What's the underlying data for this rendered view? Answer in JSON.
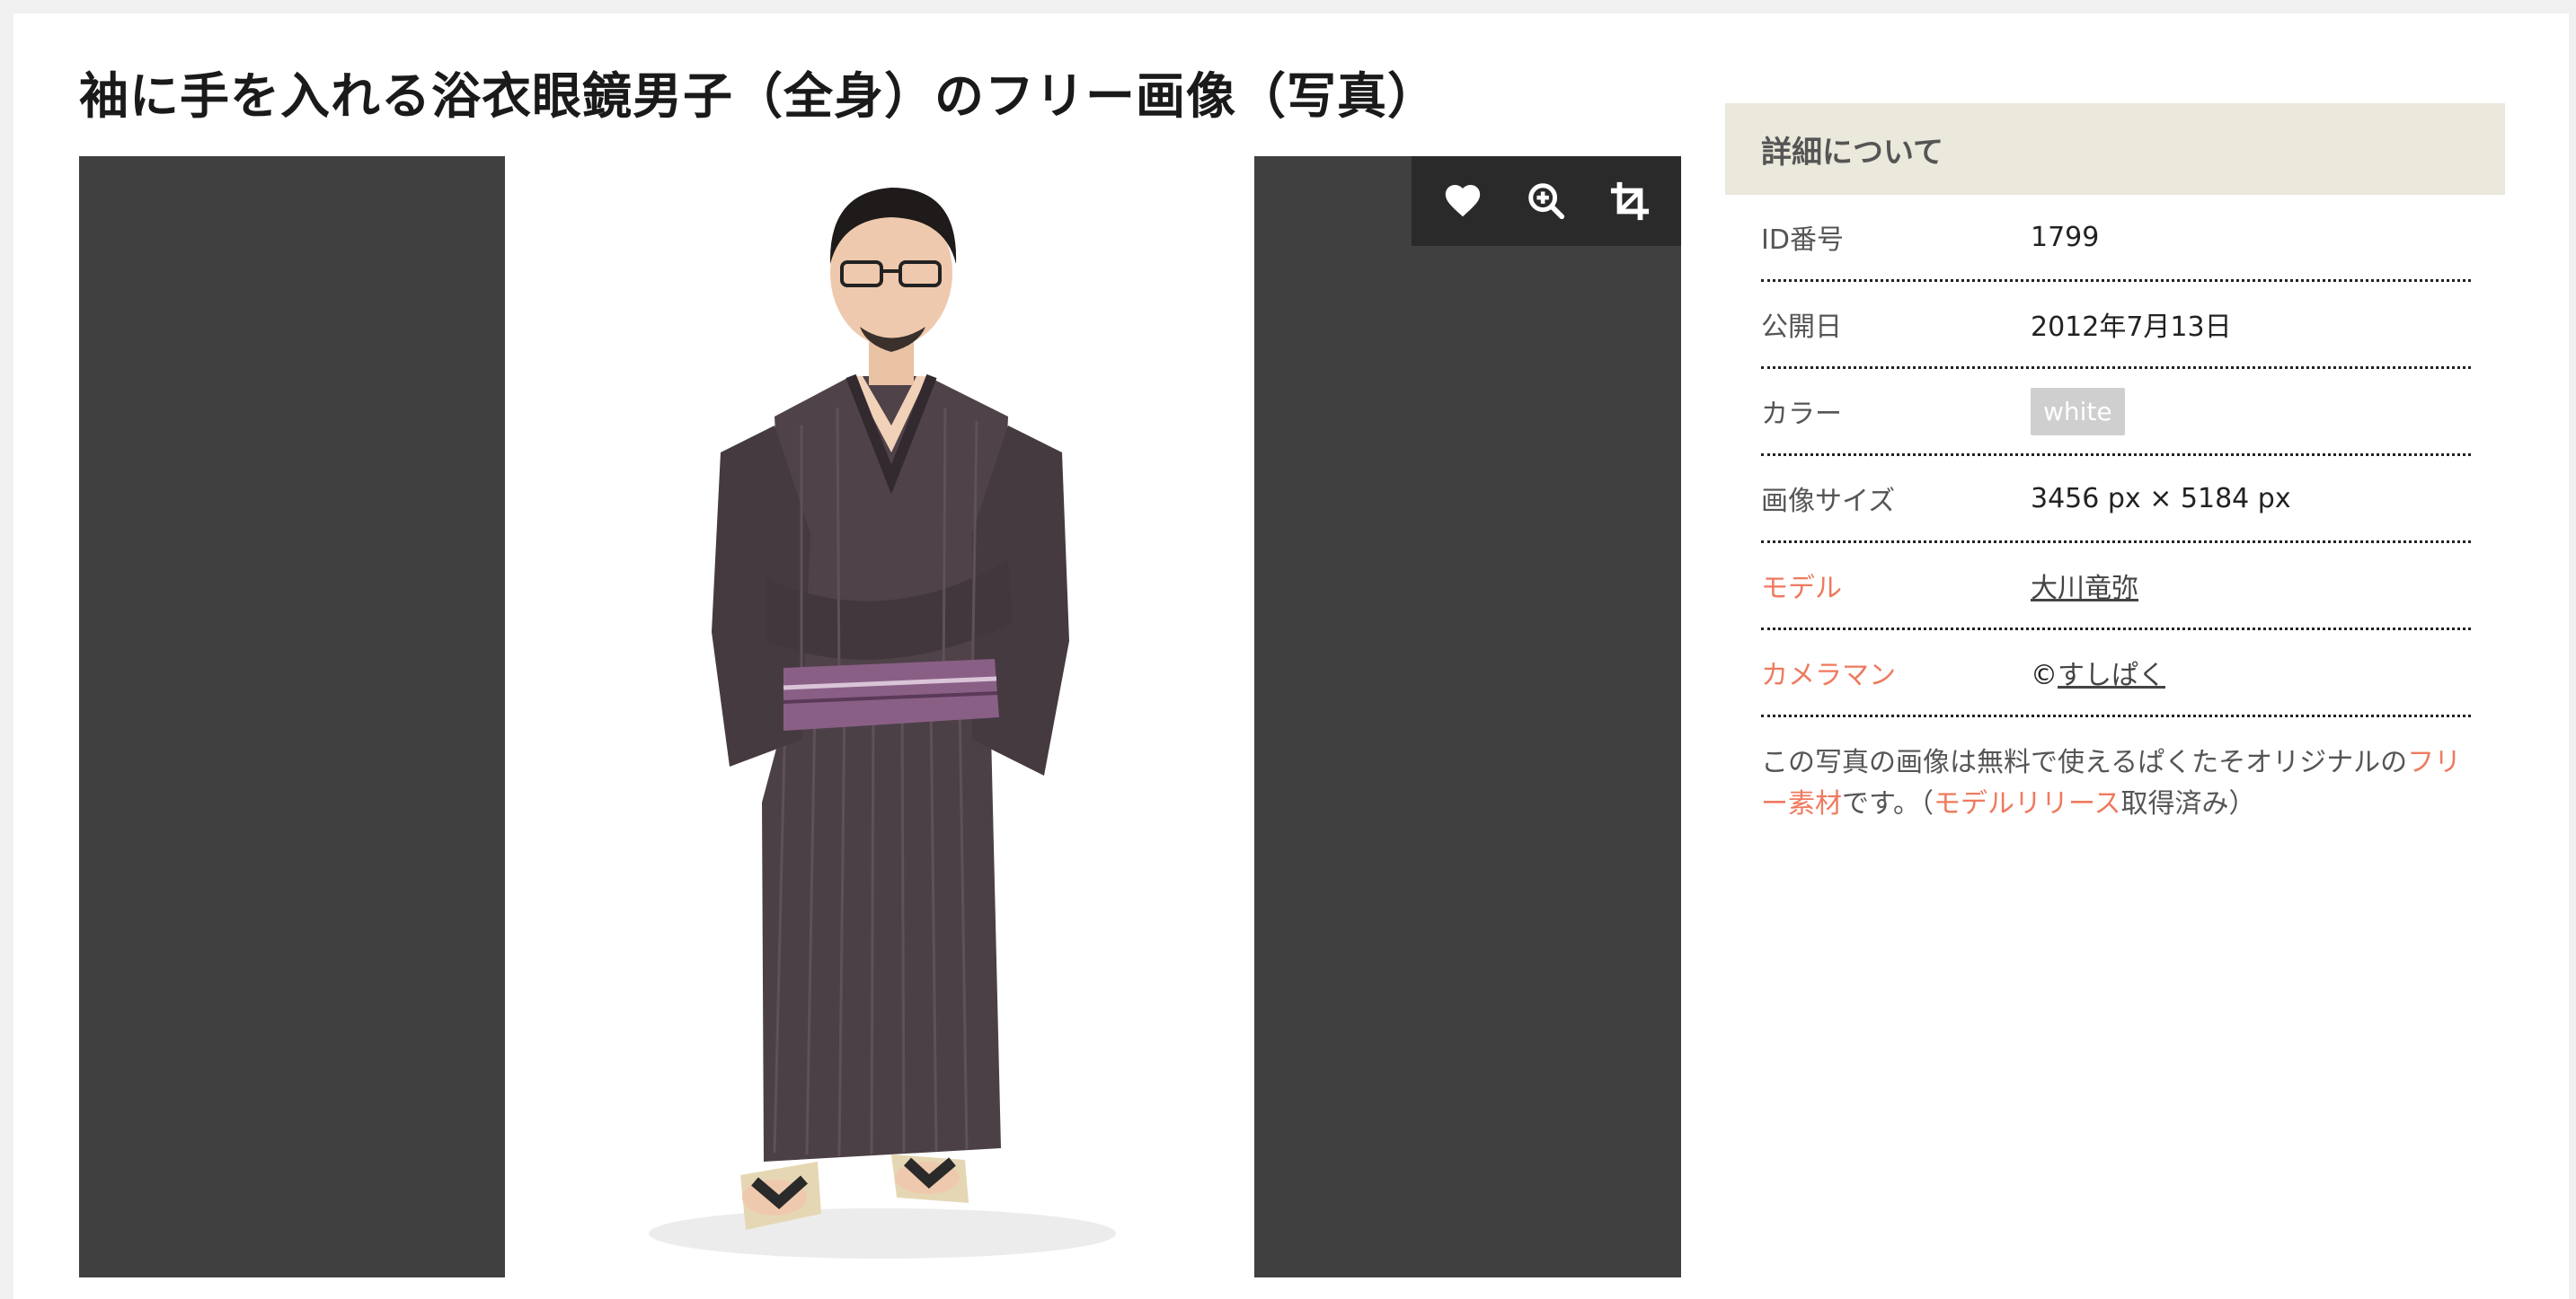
{
  "page": {
    "title": "袖に手を入れる浴衣眼鏡男子（全身）のフリー画像（写真）"
  },
  "viewer": {
    "toolbar": [
      {
        "icon": "heart-icon",
        "name": "favorite-button"
      },
      {
        "icon": "zoom-in-icon",
        "name": "zoom-button"
      },
      {
        "icon": "crop-icon",
        "name": "crop-button"
      }
    ]
  },
  "details": {
    "header": "詳細について",
    "rows": [
      {
        "label": "ID番号",
        "value": "1799"
      },
      {
        "label": "公開日",
        "value": "2012年7月13日"
      },
      {
        "label": "カラー",
        "value": "white"
      },
      {
        "label": "画像サイズ",
        "value": "3456 px × 5184 px"
      },
      {
        "label": "モデル",
        "value": "大川竜弥"
      },
      {
        "label": "カメラマン",
        "prefix": "©",
        "value": "すしぱく"
      }
    ],
    "note": {
      "part1": "この写真の画像は無料で使えるぱくたそオリジナルの",
      "link1": "フリー素材",
      "part2": "です。（",
      "link2": "モデルリリース",
      "part3": "取得済み）"
    }
  },
  "colors": {
    "accent": "#ee7a5e",
    "viewer_bg": "#404040",
    "toolbar_bg": "#2a2a2a",
    "panel_header_bg": "#ebe8dc",
    "badge_bg": "#cfcfcf"
  }
}
